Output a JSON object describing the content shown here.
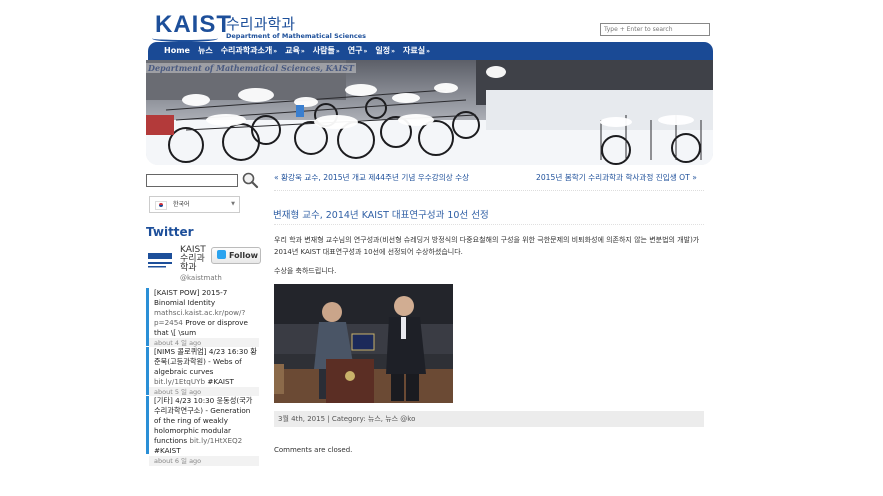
{
  "header": {
    "logo_text": "KAIST",
    "dept_korean": "수리과학과",
    "dept_english": "Department of Mathematical Sciences",
    "search_placeholder": "Type + Enter to search"
  },
  "nav": {
    "items": [
      {
        "label": "Home",
        "has_dropdown": false
      },
      {
        "label": "뉴스",
        "has_dropdown": false
      },
      {
        "label": "수리과학과소개",
        "has_dropdown": true
      },
      {
        "label": "교육",
        "has_dropdown": true
      },
      {
        "label": "사람들",
        "has_dropdown": true
      },
      {
        "label": "연구",
        "has_dropdown": true
      },
      {
        "label": "일정",
        "has_dropdown": true
      },
      {
        "label": "자료실",
        "has_dropdown": true
      }
    ],
    "chevron": "»"
  },
  "banner": {
    "caption": "Department of Mathematical Sciences, KAIST"
  },
  "sidebar": {
    "search_icon": "magnifier-icon",
    "language": "한국어",
    "twitter": {
      "title": "Twitter",
      "account_name": "KAIST 수리과학과",
      "handle": "@kaistmath",
      "follow_label": "Follow",
      "tweets": [
        {
          "text": "[KAIST POW] 2015-7 Binomial Identity",
          "link": "mathsci.kaist.ac.kr/pow/?p=2454",
          "tail": "Prove or disprove that \\[ \\sum",
          "ago": "about 4 일 ago"
        },
        {
          "text": "[NIMS 콜로퀴엄] 4/23 16:30 황준묵(고등과학원) - Webs of algebraic curves",
          "link": "bit.ly/1EtqUYb",
          "tail": "#KAIST",
          "ago": "about 5 일 ago"
        },
        {
          "text": "[기타] 4/23 10:30 윤동성(국가수리과학연구소) - Generation of the ring of weakly holomorphic modular functions",
          "link": "bit.ly/1HtXEQ2",
          "tail": "#KAIST",
          "ago": "about 6 일 ago"
        }
      ]
    }
  },
  "post_nav": {
    "prev": "« 황강욱 교수, 2015년 개교 제44주년 기념 우수강의상 수상",
    "next": "2015년 봄학기 수리과학과 학사과정 진입생 OT »"
  },
  "post": {
    "title": "변재형 교수, 2014년 KAIST 대표연구성과 10선 선정",
    "body": "우리 학과 변재형 교수님의 연구성과(비선형 슈레딩거 방정식의 다중요철해의 구성을 위한 극한문제의 비퇴화성에 의존하지 않는 변분법의 개발)가 2014년 KAIST 대표연구성과 10선에 선정되어 수상하셨습니다.",
    "congrats": "수상을 축하드립니다.",
    "meta": "3월 4th, 2015 | Category: 뉴스, 뉴스 @ko",
    "comments_closed": "Comments are closed."
  },
  "colors": {
    "brand_blue": "#1d4f9a",
    "nav_bg": "#1a4a95",
    "twitter_blue": "#2aa3ef"
  }
}
